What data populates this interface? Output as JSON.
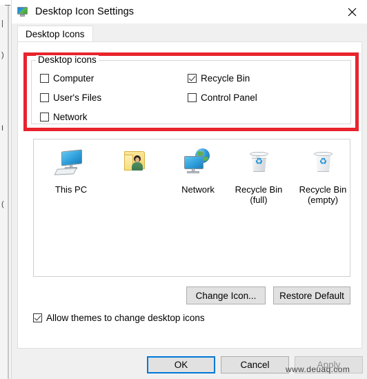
{
  "window": {
    "title": "Desktop Icon Settings",
    "icon": "monitor-personalization-icon",
    "close_label": "✕"
  },
  "tabs": [
    {
      "label": "Desktop Icons",
      "selected": true
    }
  ],
  "group": {
    "legend": "Desktop icons",
    "checkboxes": [
      {
        "label": "Computer",
        "checked": false,
        "column": "left",
        "row": 0
      },
      {
        "label": "User's Files",
        "checked": false,
        "column": "left",
        "row": 1
      },
      {
        "label": "Network",
        "checked": false,
        "column": "left",
        "row": 2
      },
      {
        "label": "Recycle Bin",
        "checked": true,
        "column": "right",
        "row": 0
      },
      {
        "label": "Control Panel",
        "checked": false,
        "column": "right",
        "row": 1
      }
    ]
  },
  "preview": {
    "icons": [
      {
        "caption": "This PC",
        "icon": "computer-monitor-icon"
      },
      {
        "caption": "",
        "icon": "user-files-folder-icon"
      },
      {
        "caption": "Network",
        "icon": "network-globe-icon"
      },
      {
        "caption": "Recycle Bin\n(full)",
        "icon": "recycle-bin-full-icon"
      },
      {
        "caption": "Recycle Bin\n(empty)",
        "icon": "recycle-bin-empty-icon"
      }
    ]
  },
  "buttons": {
    "change_icon": "Change Icon...",
    "restore_default": "Restore Default",
    "ok": "OK",
    "cancel": "Cancel",
    "apply": "Apply"
  },
  "allow_themes": {
    "label": "Allow themes to change desktop icons",
    "checked": true
  },
  "annotation": {
    "shape": "rectangle",
    "color": "#e8242c"
  },
  "watermark": {
    "text": "www.deuaq.com"
  },
  "colors": {
    "accent": "#0078d7",
    "annotation_red": "#e8242c",
    "dialog_bg": "#f0f0f0",
    "content_bg": "#ffffff",
    "button_bg": "#e1e1e1"
  }
}
